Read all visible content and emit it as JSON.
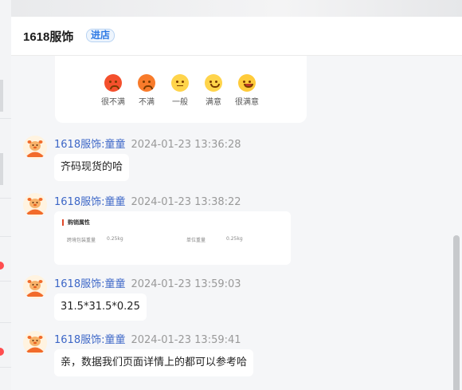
{
  "chat": {
    "shop_name": "1618服饰",
    "enter_store_label": "进店"
  },
  "rating": {
    "options": [
      {
        "label": "很不满",
        "icon": "very-dissatisfied-emoji"
      },
      {
        "label": "不满",
        "icon": "dissatisfied-emoji"
      },
      {
        "label": "一般",
        "icon": "neutral-emoji"
      },
      {
        "label": "满意",
        "icon": "satisfied-emoji"
      },
      {
        "label": "很满意",
        "icon": "very-satisfied-emoji"
      }
    ]
  },
  "messages": [
    {
      "sender": "1618服饰:童童",
      "time": "2024-01-23 13:36:28",
      "text": "齐码现货的哈"
    },
    {
      "sender": "1618服饰:童童",
      "time": "2024-01-23 13:38:22",
      "card": {
        "title": "购销属性",
        "rows": [
          {
            "label": "跨境包装重量",
            "value": "0.25kg"
          },
          {
            "label": "单位重量",
            "value": "0.25kg"
          }
        ]
      }
    },
    {
      "sender": "1618服饰:童童",
      "time": "2024-01-23 13:59:03",
      "text": "31.5*31.5*0.25"
    },
    {
      "sender": "1618服饰:童童",
      "time": "2024-01-23 13:59:41",
      "text": "亲，数据我们页面详情上的都可以参考哈"
    }
  ],
  "colors": {
    "accent_blue": "#2f7ae5",
    "sender_blue": "#3d67c7",
    "card_accent_red": "#e0492a",
    "badge_red": "#ff4d4f"
  }
}
